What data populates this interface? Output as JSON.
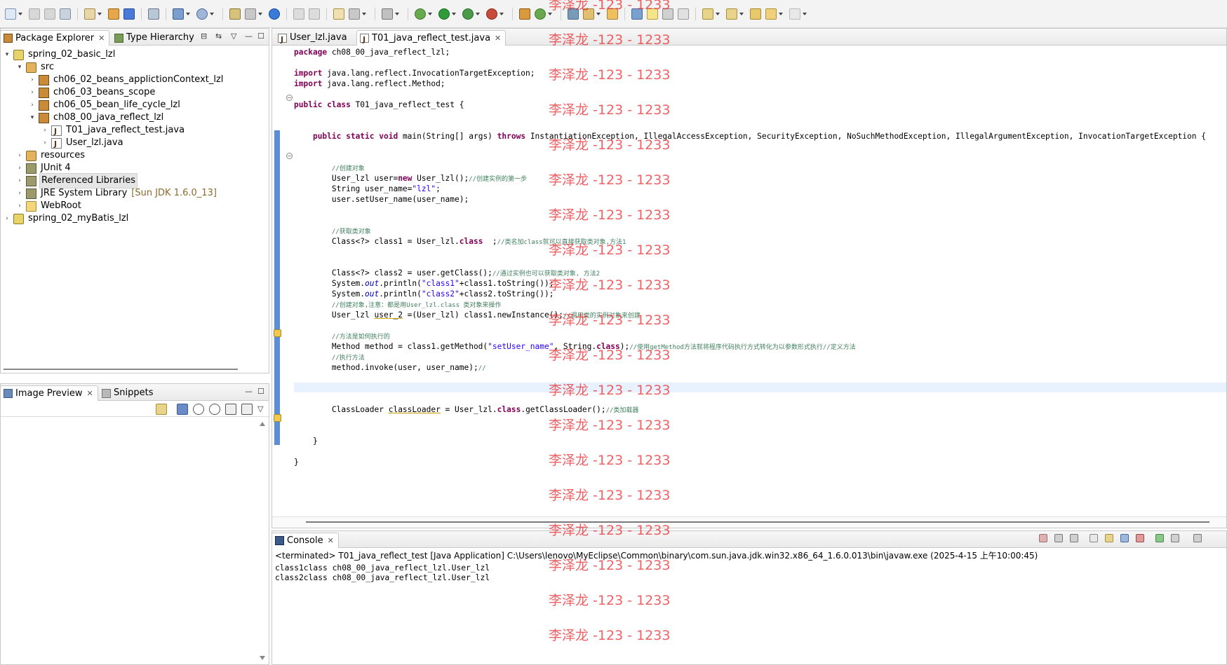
{
  "toolbar": {
    "icons": [
      "new-icon",
      "save-icon",
      "save-all-icon",
      "print-icon",
      "new-wizard-icon",
      "open-type-icon",
      "open-resource-icon",
      "search-icon",
      "debug-icon",
      "run-icon",
      "external-tools-icon",
      "open-perspective-icon",
      "deploy-icon",
      "server-icon",
      "browser-icon",
      "prev-annotation-icon",
      "next-annotation-icon",
      "back-icon",
      "forward-icon"
    ]
  },
  "package_explorer": {
    "tabs": [
      {
        "label": "Package Explorer",
        "close": "✕"
      },
      {
        "label": "Type Hierarchy"
      }
    ],
    "tree": [
      {
        "label": "spring_02_basic_lzl",
        "depth": 0,
        "twisty": "▾",
        "icon": "project-icon"
      },
      {
        "label": "src",
        "depth": 1,
        "twisty": "▾",
        "icon": "source-folder-icon"
      },
      {
        "label": "ch06_02_beans_applictionContext_lzl",
        "depth": 2,
        "twisty": "›",
        "icon": "package-icon"
      },
      {
        "label": "ch06_03_beans_scope",
        "depth": 2,
        "twisty": "›",
        "icon": "package-icon"
      },
      {
        "label": "ch06_05_bean_life_cycle_lzl",
        "depth": 2,
        "twisty": "›",
        "icon": "package-icon"
      },
      {
        "label": "ch08_00_java_reflect_lzl",
        "depth": 2,
        "twisty": "▾",
        "icon": "package-icon"
      },
      {
        "label": "T01_java_reflect_test.java",
        "depth": 3,
        "twisty": "›",
        "icon": "java-file-icon"
      },
      {
        "label": "User_lzl.java",
        "depth": 3,
        "twisty": "›",
        "icon": "java-file-icon"
      },
      {
        "label": "resources",
        "depth": 1,
        "twisty": "›",
        "icon": "source-folder-icon"
      },
      {
        "label": "JUnit 4",
        "depth": 1,
        "twisty": "›",
        "icon": "library-icon"
      },
      {
        "label": "Referenced Libraries",
        "depth": 1,
        "twisty": "›",
        "icon": "library-icon",
        "selected": true
      },
      {
        "label": "JRE System Library",
        "extra": "[Sun JDK 1.6.0_13]",
        "depth": 1,
        "twisty": "›",
        "icon": "library-icon"
      },
      {
        "label": "WebRoot",
        "depth": 1,
        "twisty": "›",
        "icon": "folder-icon"
      },
      {
        "label": "spring_02_myBatis_lzl",
        "depth": 0,
        "twisty": "›",
        "icon": "project-icon"
      }
    ]
  },
  "image_preview": {
    "tabs": [
      {
        "label": "Image Preview",
        "close": "✕"
      },
      {
        "label": "Snippets"
      }
    ]
  },
  "editor": {
    "tabs": [
      {
        "label": "User_lzl.java"
      },
      {
        "label": "T01_java_reflect_test.java",
        "close": "✕",
        "active": true
      }
    ]
  },
  "console": {
    "tab": {
      "label": "Console",
      "close": "✕"
    },
    "terminated_line": "<terminated> T01_java_reflect_test [Java Application] C:\\Users\\lenovo\\MyEclipse\\Common\\binary\\com.sun.java.jdk.win32.x86_64_1.6.0.013\\bin\\javaw.exe (2025-4-15 上午10:00:45)",
    "output": [
      "class1class ch08_00_java_reflect_lzl.User_lzl",
      "class2class ch08_00_java_reflect_lzl.User_lzl"
    ]
  },
  "watermark": "李泽龙 -123 - 1233"
}
